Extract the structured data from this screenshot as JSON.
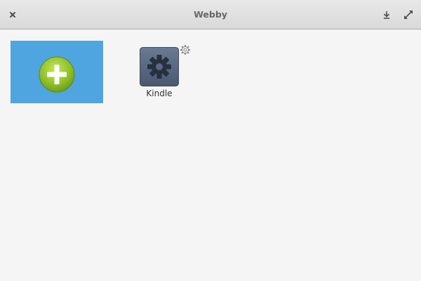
{
  "window": {
    "title": "Webby"
  },
  "headerbar": {
    "close_icon": "close-icon",
    "download_icon": "download-icon",
    "maximize_icon": "maximize-icon"
  },
  "add_tile": {
    "icon": "add-icon",
    "background_color": "#4ea5df",
    "icon_color": "#8fc129"
  },
  "apps": [
    {
      "label": "Kindle",
      "icon": "gear-icon",
      "settings_icon": "gear-icon"
    }
  ]
}
